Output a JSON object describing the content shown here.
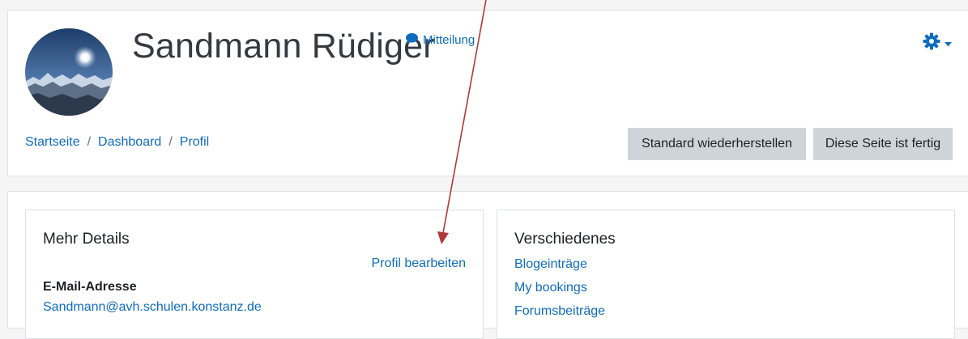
{
  "header": {
    "user_name": "Sandmann Rüdiger",
    "message_label": "Mitteilung",
    "breadcrumb": [
      "Startseite",
      "Dashboard",
      "Profil"
    ],
    "buttons": {
      "reset": "Standard wiederherstellen",
      "done": "Diese Seite ist fertig"
    }
  },
  "details_block": {
    "title": "Mehr Details",
    "edit_link": "Profil bearbeiten",
    "email_label": "E-Mail-Adresse",
    "email_value": "Sandmann@avh.schulen.konstanz.de"
  },
  "misc_block": {
    "title": "Verschiedenes",
    "links": [
      "Blogeinträge",
      "My bookings",
      "Forumsbeiträge"
    ]
  },
  "colors": {
    "link": "#0f6cbf",
    "button_bg": "#ced4da",
    "annotation_arrow": "#b03a3a"
  },
  "icons": {
    "message": "speech-bubble-icon",
    "settings": "gear-icon",
    "settings_menu": "caret-down-icon"
  }
}
